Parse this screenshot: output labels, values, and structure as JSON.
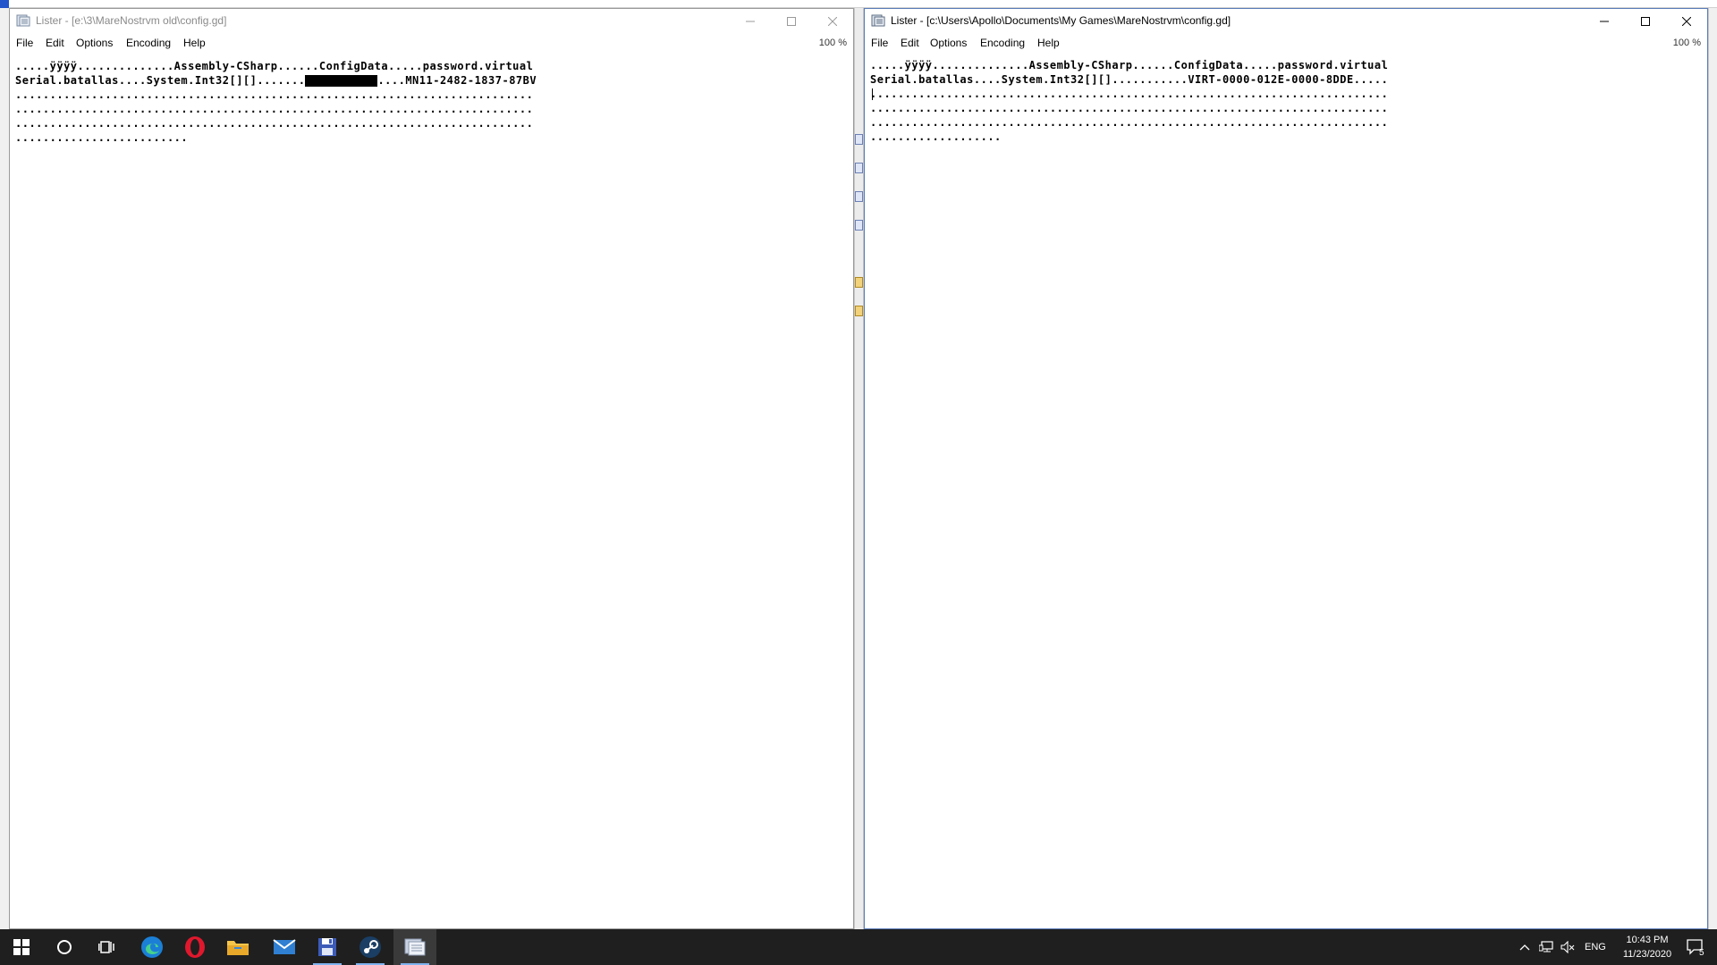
{
  "left_window": {
    "title": "Lister - [e:\\3\\MareNostrvm old\\config.gd]",
    "menu": [
      "File",
      "Edit",
      "Options",
      "Encoding",
      "Help"
    ],
    "zoom": "100 %",
    "line1": ".....ÿÿÿÿ..............Assembly-CSharp......ConfigData.....password.virtual",
    "line2_before": "Serial.batallas....System.Int32[][].......",
    "line2_after": "....MN11-2482-1837-87BV",
    "dots_lines": [
      "...........................................................................",
      "...........................................................................",
      "...........................................................................",
      "........................."
    ]
  },
  "right_window": {
    "title": "Lister - [c:\\Users\\Apollo\\Documents\\My Games\\MareNostrvm\\config.gd]",
    "menu": [
      "File",
      "Edit",
      "Options",
      "Encoding",
      "Help"
    ],
    "zoom": "100 %",
    "line1": ".....ÿÿÿÿ..............Assembly-CSharp......ConfigData.....password.virtual",
    "line2": "Serial.batallas....System.Int32[][]...........VIRT-0000-012E-0000-8DDE.....",
    "dots_lines": [
      "...........................................................................",
      "...........................................................................",
      "...........................................................................",
      "..................."
    ]
  },
  "taskbar": {
    "language": "ENG",
    "time": "10:43 PM",
    "date": "11/23/2020",
    "notification_count": "5",
    "apps": [
      "start-icon",
      "cortana-search-icon",
      "task-view-icon",
      "edge-icon",
      "opera-icon",
      "file-explorer-icon",
      "mail-icon",
      "save-disk-icon",
      "steam-icon",
      "lister-icon"
    ],
    "accent": "#7fb3f0",
    "taskbar_color": "#1f1f1f"
  }
}
